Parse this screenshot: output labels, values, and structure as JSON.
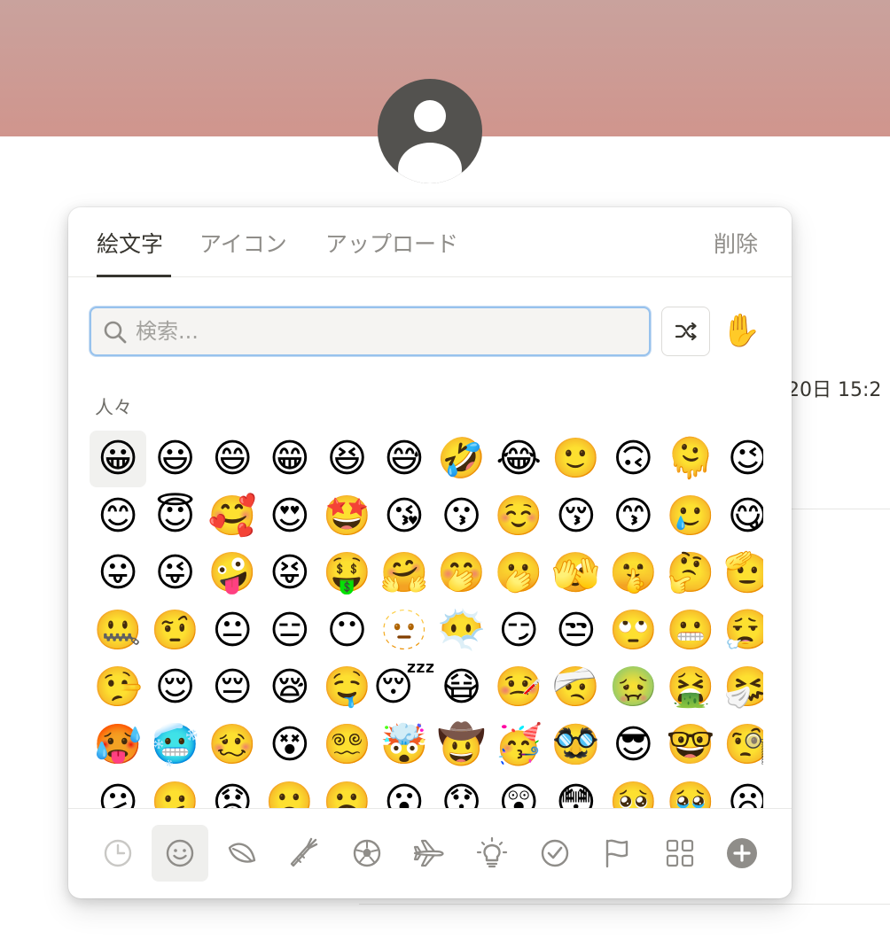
{
  "background": {
    "date_text": "20日 15:2"
  },
  "picker": {
    "tabs": [
      {
        "label": "絵文字"
      },
      {
        "label": "アイコン"
      },
      {
        "label": "アップロード"
      }
    ],
    "remove_label": "削除",
    "search": {
      "placeholder": "検索..."
    },
    "skin_tone_emoji": "✋",
    "section_label": "人々",
    "emojis": [
      "😀",
      "😃",
      "😄",
      "😁",
      "😆",
      "😅",
      "🤣",
      "😂",
      "🙂",
      "🙃",
      "🫠",
      "😉",
      "😊",
      "😇",
      "🥰",
      "😍",
      "🤩",
      "😘",
      "😗",
      "☺️",
      "😚",
      "😙",
      "🥲",
      "😋",
      "😛",
      "😜",
      "🤪",
      "😝",
      "🤑",
      "🤗",
      "🤭",
      "🫢",
      "🫣",
      "🤫",
      "🤔",
      "🫡",
      "🤐",
      "🤨",
      "😐",
      "😑",
      "😶",
      "🫥",
      "😶‍🌫️",
      "😏",
      "😒",
      "🙄",
      "😬",
      "😮‍💨",
      "🤥",
      "😌",
      "😔",
      "😪",
      "🤤",
      "😴",
      "😷",
      "🤒",
      "🤕",
      "🤢",
      "🤮",
      "🤧",
      "🥵",
      "🥶",
      "🥴",
      "😵",
      "😵‍💫",
      "🤯",
      "🤠",
      "🥳",
      "🥸",
      "😎",
      "🤓",
      "🧐",
      "😕",
      "🫤",
      "😟",
      "🙁",
      "☹️",
      "😮",
      "😯",
      "😲",
      "😳",
      "🥺",
      "🥹",
      "😦"
    ],
    "categories": [
      {
        "name": "recent-icon"
      },
      {
        "name": "smiley-icon"
      },
      {
        "name": "leaf-icon"
      },
      {
        "name": "carrot-icon"
      },
      {
        "name": "soccer-ball-icon"
      },
      {
        "name": "airplane-icon"
      },
      {
        "name": "lightbulb-icon"
      },
      {
        "name": "checkmark-circle-icon"
      },
      {
        "name": "flag-icon"
      },
      {
        "name": "grid-icon"
      },
      {
        "name": "plus-circle-icon"
      }
    ]
  }
}
